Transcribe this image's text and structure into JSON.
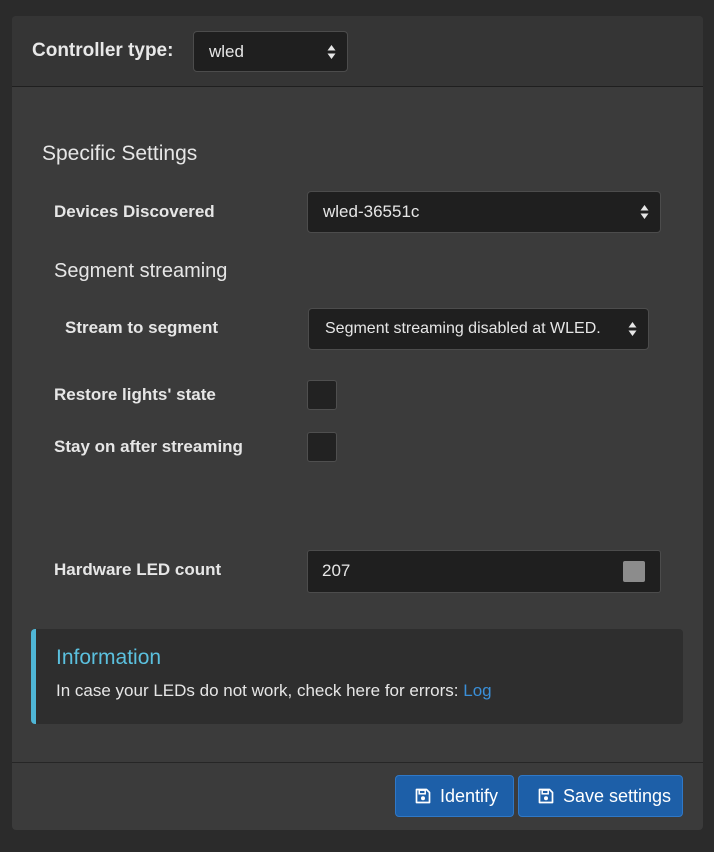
{
  "header": {
    "controller_type_label": "Controller type:",
    "controller_type_value": "wled"
  },
  "specific": {
    "heading": "Specific Settings",
    "devices_label": "Devices Discovered",
    "devices_value": "wled-36551c",
    "segment_heading": "Segment streaming",
    "stream_label": "Stream to segment",
    "stream_value": "Segment streaming disabled at WLED.",
    "restore_label": "Restore lights' state",
    "restore_checked": false,
    "stay_label": "Stay on after streaming",
    "stay_checked": false,
    "hw_led_label": "Hardware LED count",
    "hw_led_value": "207"
  },
  "info": {
    "title": "Information",
    "text": "In case your LEDs do not work, check here for errors: ",
    "link": "Log"
  },
  "footer": {
    "identify_label": "Identify",
    "save_label": "Save settings"
  },
  "colors": {
    "primary_button": "#1d5fa8",
    "info_accent": "#5bc0de",
    "link": "#3a8fd8"
  },
  "icons": {
    "select_arrows": "up-down-arrows-icon",
    "buttons": "floppy-disk-icon"
  }
}
